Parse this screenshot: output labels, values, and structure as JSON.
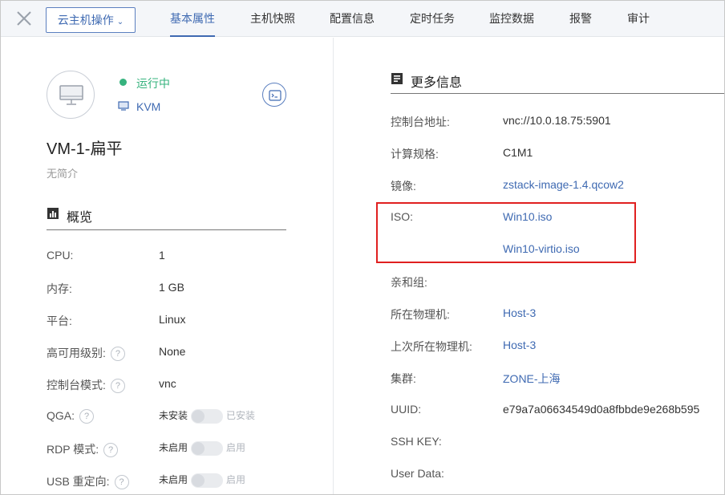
{
  "topbar": {
    "actions_label": "云主机操作",
    "tabs": [
      {
        "label": "基本属性",
        "active": true
      },
      {
        "label": "主机快照",
        "active": false
      },
      {
        "label": "配置信息",
        "active": false
      },
      {
        "label": "定时任务",
        "active": false
      },
      {
        "label": "监控数据",
        "active": false
      },
      {
        "label": "报警",
        "active": false
      },
      {
        "label": "审计",
        "active": false
      }
    ]
  },
  "vm": {
    "status": "运行中",
    "hypervisor": "KVM",
    "name": "VM-1-扁平",
    "description": "无简介"
  },
  "overview": {
    "title": "概览",
    "items": [
      {
        "label": "CPU:",
        "value": "1"
      },
      {
        "label": "内存:",
        "value": "1 GB"
      },
      {
        "label": "平台:",
        "value": "Linux"
      },
      {
        "label": "高可用级别:",
        "value": "None",
        "help": "?"
      },
      {
        "label": "控制台模式:",
        "value": "vnc",
        "help": "?"
      }
    ],
    "toggles": [
      {
        "label": "QGA:",
        "help": "?",
        "off": "未安装",
        "on": "已安装"
      },
      {
        "label": "RDP 模式:",
        "help": "?",
        "off": "未启用",
        "on": "启用"
      },
      {
        "label": "USB 重定向:",
        "help": "?",
        "off": "未启用",
        "on": "启用"
      }
    ]
  },
  "more_info": {
    "title": "更多信息",
    "items": [
      {
        "label": "控制台地址:",
        "value": "vnc://10.0.18.75:5901",
        "link": false
      },
      {
        "label": "计算规格:",
        "value": "C1M1",
        "link": false
      },
      {
        "label": "镜像:",
        "value": "zstack-image-1.4.qcow2",
        "link": true
      },
      {
        "label": "ISO:",
        "value": "Win10.iso",
        "link": true
      },
      {
        "label": "",
        "value": "Win10-virtio.iso",
        "link": true
      },
      {
        "label": "亲和组:",
        "value": "",
        "link": false
      },
      {
        "label": "所在物理机:",
        "value": "Host-3",
        "link": true
      },
      {
        "label": "上次所在物理机:",
        "value": "Host-3",
        "link": true
      },
      {
        "label": "集群:",
        "value": "ZONE-上海",
        "link": true
      },
      {
        "label": "UUID:",
        "value": "e79a7a06634549d0a8fbbde9e268b595",
        "link": false
      },
      {
        "label": "SSH KEY:",
        "value": "",
        "link": false
      },
      {
        "label": "User Data:",
        "value": "",
        "link": false
      }
    ]
  },
  "colors": {
    "accent": "#3f6ab2",
    "running": "#36b37e",
    "highlight": "#e02020"
  }
}
